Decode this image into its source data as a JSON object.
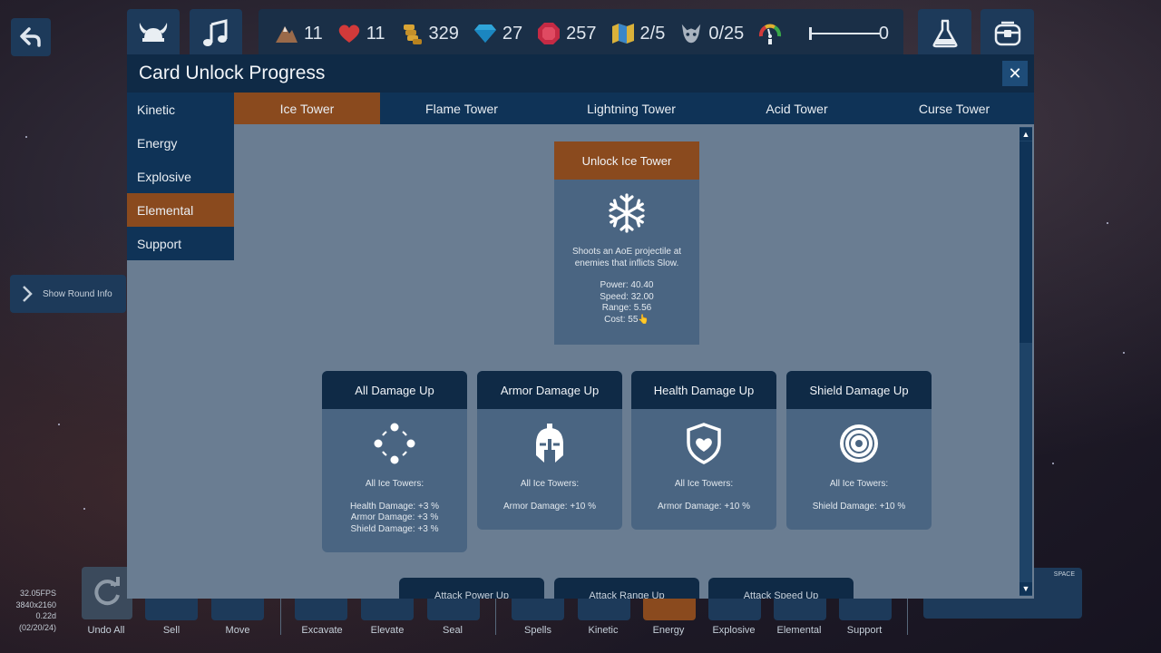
{
  "hud": {
    "resources": [
      {
        "icon": "mountain-icon",
        "value": "11"
      },
      {
        "icon": "heart-icon",
        "value": "11"
      },
      {
        "icon": "coins-icon",
        "value": "329"
      },
      {
        "icon": "diamond-icon",
        "value": "27"
      },
      {
        "icon": "ruby-icon",
        "value": "257"
      },
      {
        "icon": "map-icon",
        "value": "2/5"
      },
      {
        "icon": "monster-icon",
        "value": "0/25"
      },
      {
        "icon": "speed-gauge-icon",
        "value": ""
      }
    ],
    "slider_value": "0",
    "slider_level": 0
  },
  "modal": {
    "title": "Card Unlock Progress",
    "close_label": "✕",
    "categories": [
      "Kinetic",
      "Energy",
      "Explosive",
      "Elemental",
      "Support"
    ],
    "active_category": "Elemental",
    "tower_tabs": [
      "Ice Tower",
      "Flame Tower",
      "Lightning Tower",
      "Acid Tower",
      "Curse Tower"
    ],
    "active_tower": "Ice Tower",
    "main_card": {
      "title": "Unlock Ice Tower",
      "icon": "snowflake-icon",
      "description_1": "Shoots an AoE projectile at",
      "description_2": "enemies that inflicts Slow.",
      "power": "Power: 40.40",
      "speed": "Speed: 32.00",
      "range": "Range: 5.56",
      "cost": "Cost: 55👆"
    },
    "upgrade_cards": [
      {
        "title": "All Damage Up",
        "icon": "circle-dots-icon",
        "subtitle": "All Ice Towers:",
        "lines": [
          "Health Damage: +3 %",
          "Armor Damage: +3 %",
          "Shield Damage: +3 %"
        ]
      },
      {
        "title": "Armor Damage Up",
        "icon": "helmet-icon",
        "subtitle": "All Ice Towers:",
        "lines": [
          "Armor Damage: +10 %"
        ]
      },
      {
        "title": "Health Damage Up",
        "icon": "heart-shield-icon",
        "subtitle": "All Ice Towers:",
        "lines": [
          "Armor Damage: +10 %"
        ]
      },
      {
        "title": "Shield Damage Up",
        "icon": "target-icon",
        "subtitle": "All Ice Towers:",
        "lines": [
          "Shield Damage: +10 %"
        ]
      }
    ],
    "partial_cards": [
      "Attack Power Up",
      "Attack Range Up",
      "Attack Speed Up"
    ]
  },
  "left": {
    "round_info_label": "Show Round Info",
    "fps": "32.05FPS",
    "resolution": "3840x2160",
    "version": "0.22d",
    "date": "(02/20/24)"
  },
  "bottom": {
    "items": [
      "Undo All",
      "Sell",
      "Move",
      "Excavate",
      "Elevate",
      "Seal",
      "Spells",
      "Kinetic",
      "Energy",
      "Explosive",
      "Elemental",
      "Support"
    ],
    "space_label": "SPACE"
  }
}
